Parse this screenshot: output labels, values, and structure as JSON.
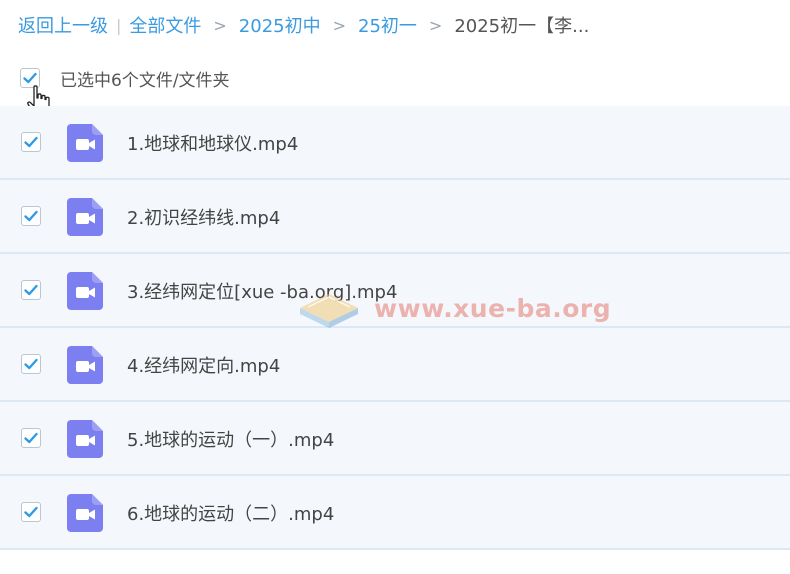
{
  "breadcrumb": {
    "back": "返回上一级",
    "items": [
      "全部文件",
      "2025初中",
      "25初一"
    ],
    "current": "2025初一【李..."
  },
  "selection": {
    "text": "已选中6个文件/文件夹",
    "checked": true
  },
  "files": [
    {
      "name": "1.地球和地球仪.mp4",
      "checked": true,
      "icon": "video-file-icon"
    },
    {
      "name": "2.初识经纬线.mp4",
      "checked": true,
      "icon": "video-file-icon"
    },
    {
      "name": "3.经纬网定位[xue -ba.org].mp4",
      "checked": true,
      "icon": "video-file-icon"
    },
    {
      "name": "4.经纬网定向.mp4",
      "checked": true,
      "icon": "video-file-icon"
    },
    {
      "name": "5.地球的运动（一）.mp4",
      "checked": true,
      "icon": "video-file-icon"
    },
    {
      "name": "6.地球的运动（二）.mp4",
      "checked": true,
      "icon": "video-file-icon"
    }
  ],
  "watermark": {
    "text": "www.xue-ba.org"
  },
  "colors": {
    "link": "#3a9be0",
    "check": "#2f9ae6",
    "video_icon": "#7b7ff0",
    "row_bg": "#f4f8fc",
    "row_border": "#dce8f3"
  }
}
